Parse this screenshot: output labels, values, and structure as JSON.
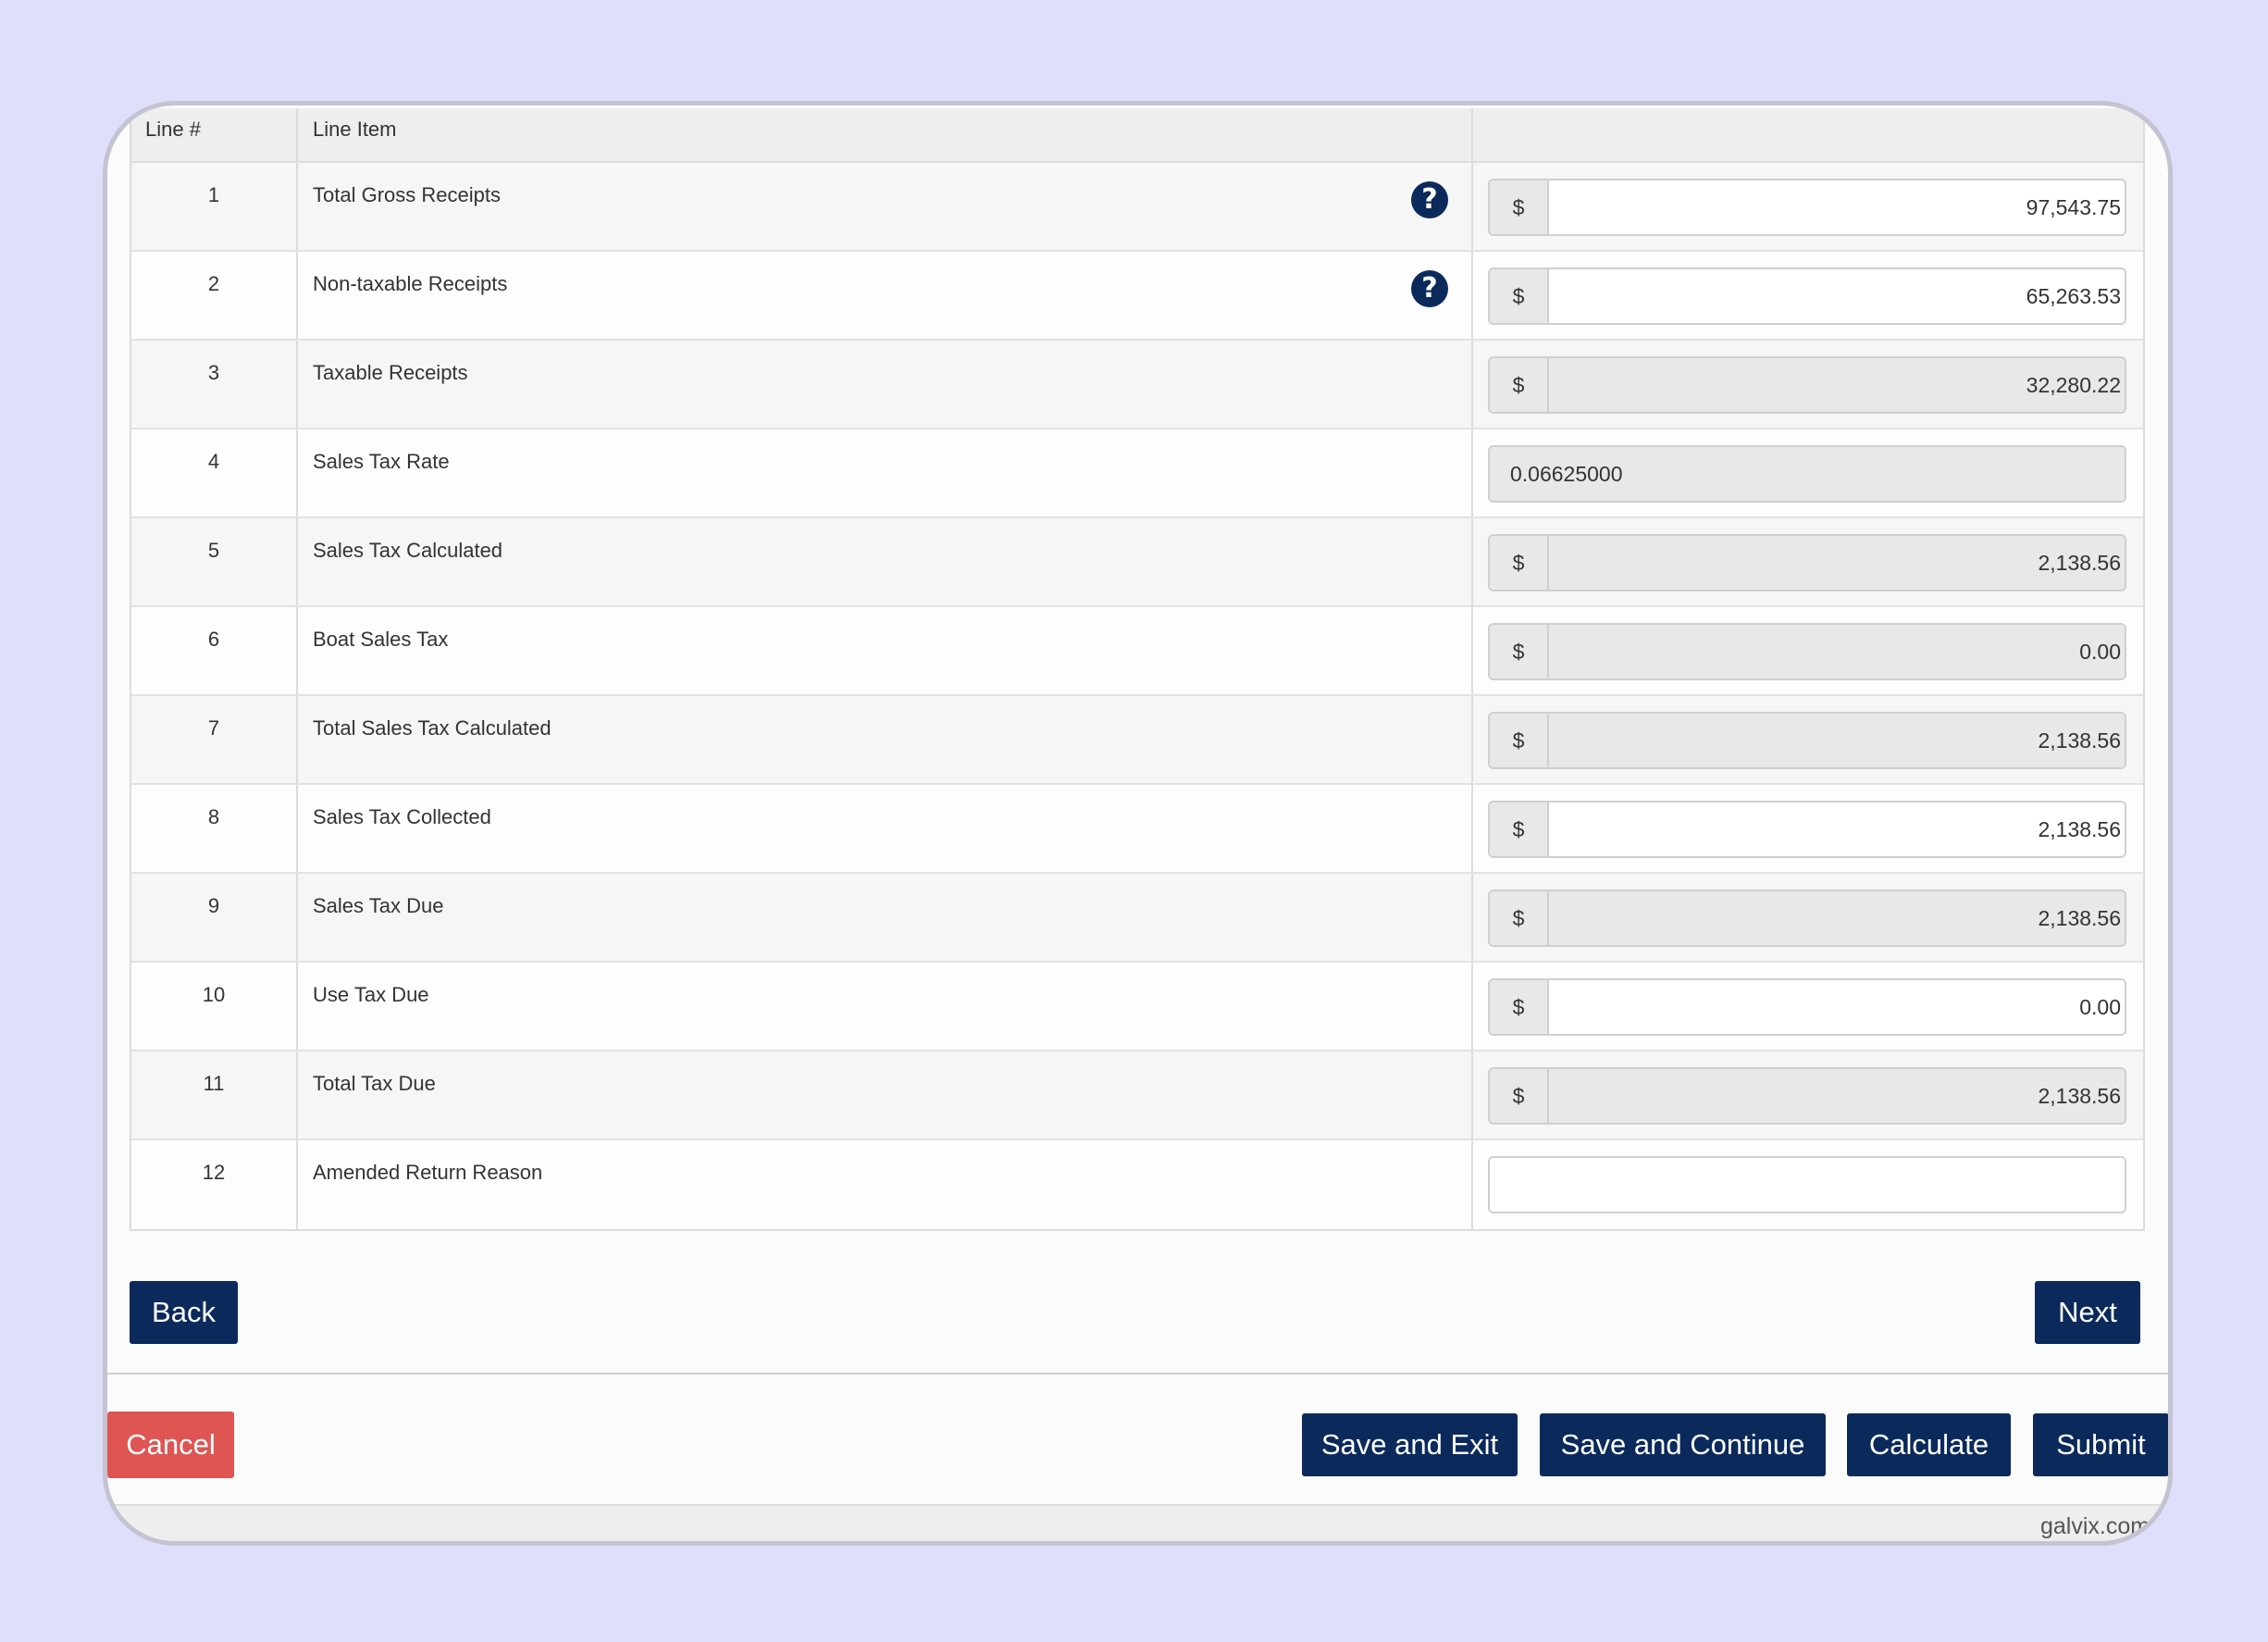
{
  "table": {
    "headers": {
      "line_num": "Line #",
      "line_item": "Line Item",
      "value": ""
    },
    "rows": [
      {
        "num": "1",
        "label": "Total Gross Receipts",
        "prefix": "$",
        "value": "97,543.75",
        "editable": true,
        "help": true
      },
      {
        "num": "2",
        "label": "Non-taxable Receipts",
        "prefix": "$",
        "value": "65,263.53",
        "editable": true,
        "help": true
      },
      {
        "num": "3",
        "label": "Taxable Receipts",
        "prefix": "$",
        "value": "32,280.22",
        "editable": false,
        "help": false
      },
      {
        "num": "4",
        "label": "Sales Tax Rate",
        "prefix": "",
        "value": "0.06625000",
        "editable": false,
        "help": false
      },
      {
        "num": "5",
        "label": "Sales Tax Calculated",
        "prefix": "$",
        "value": "2,138.56",
        "editable": false,
        "help": false
      },
      {
        "num": "6",
        "label": "Boat Sales Tax",
        "prefix": "$",
        "value": "0.00",
        "editable": false,
        "help": false
      },
      {
        "num": "7",
        "label": "Total Sales Tax Calculated",
        "prefix": "$",
        "value": "2,138.56",
        "editable": false,
        "help": false
      },
      {
        "num": "8",
        "label": "Sales Tax Collected",
        "prefix": "$",
        "value": "2,138.56",
        "editable": true,
        "help": false
      },
      {
        "num": "9",
        "label": "Sales Tax Due",
        "prefix": "$",
        "value": "2,138.56",
        "editable": false,
        "help": false
      },
      {
        "num": "10",
        "label": "Use Tax Due",
        "prefix": "$",
        "value": "0.00",
        "editable": true,
        "help": false
      },
      {
        "num": "11",
        "label": "Total Tax Due",
        "prefix": "$",
        "value": "2,138.56",
        "editable": false,
        "help": false
      },
      {
        "num": "12",
        "label": "Amended Return Reason",
        "prefix": "",
        "value": "",
        "editable": true,
        "help": false
      }
    ]
  },
  "nav": {
    "back_label": "Back",
    "next_label": "Next"
  },
  "actions": {
    "cancel_label": "Cancel",
    "save_exit_label": "Save and Exit",
    "save_continue_label": "Save and Continue",
    "calculate_label": "Calculate",
    "submit_label": "Submit"
  },
  "watermark": "galvix.com",
  "icons": {
    "help": "question-circle-icon"
  },
  "colors": {
    "primary": "#0b2a5b",
    "danger": "#de5553",
    "background": "#dfdefb"
  }
}
